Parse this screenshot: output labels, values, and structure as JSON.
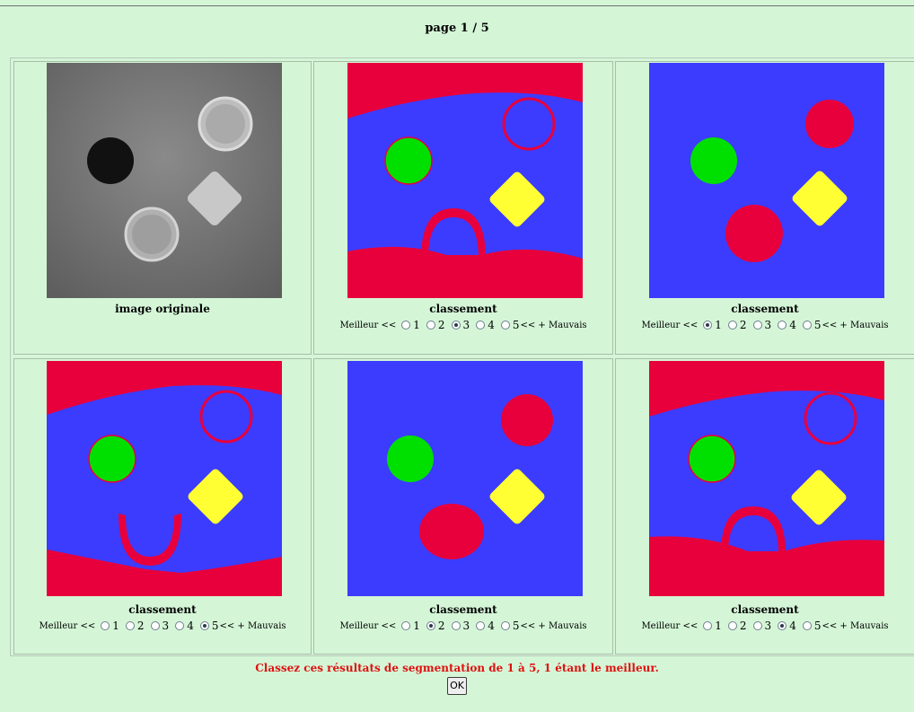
{
  "header": {
    "page_label": "page 1 / 5"
  },
  "cells": [
    {
      "caption": "image originale",
      "kind": "original"
    },
    {
      "caption": "classement",
      "kind": "seg-a",
      "selected": 3
    },
    {
      "caption": "classement",
      "kind": "seg-b",
      "selected": 1
    },
    {
      "caption": "classement",
      "kind": "seg-c",
      "selected": 5
    },
    {
      "caption": "classement",
      "kind": "seg-b2",
      "selected": 2
    },
    {
      "caption": "classement",
      "kind": "seg-a2",
      "selected": 4
    }
  ],
  "rank_scale": {
    "best_label": "Meilleur <<",
    "worst_label": "<< + Mauvais",
    "options": [
      "1",
      "2",
      "3",
      "4",
      "5"
    ]
  },
  "footer": {
    "instruction": "Classez ces résultats de segmentation de 1 à 5, 1 étant le meilleur.",
    "ok_label": "OK"
  },
  "colors": {
    "background": "#d4f6d7",
    "segment_red": "#e8003c",
    "segment_blue": "#3c3cff",
    "segment_green": "#00e000",
    "segment_yellow": "#ffff33",
    "instruction_text": "#e01010"
  }
}
